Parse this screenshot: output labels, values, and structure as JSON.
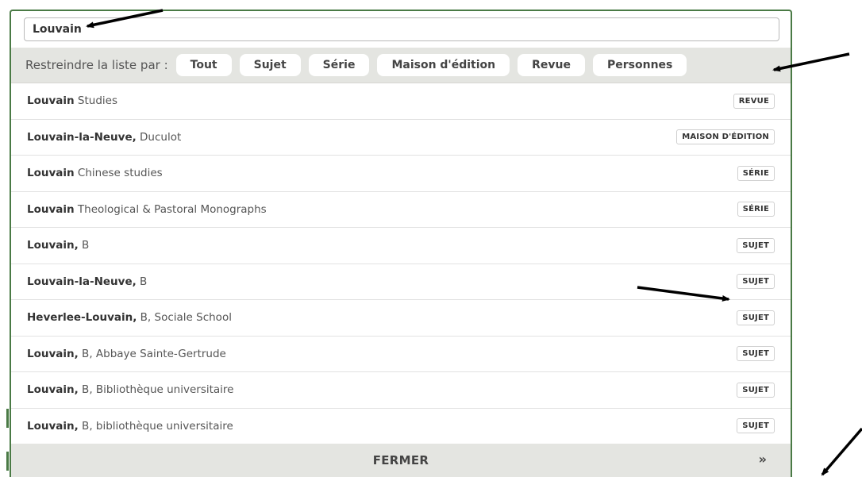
{
  "search": {
    "value": "Louvain"
  },
  "filter": {
    "label": "Restreindre la liste par :",
    "chips": [
      "Tout",
      "Sujet",
      "Série",
      "Maison d'édition",
      "Revue",
      "Personnes"
    ]
  },
  "results": [
    {
      "bold": "Louvain",
      "rest": " Studies",
      "badge": "REVUE"
    },
    {
      "bold": "Louvain-la-Neuve,",
      "rest": " Duculot",
      "badge": "MAISON D'ÉDITION"
    },
    {
      "bold": "Louvain",
      "rest": " Chinese studies",
      "badge": "SÉRIE"
    },
    {
      "bold": "Louvain",
      "rest": " Theological & Pastoral Monographs",
      "badge": "SÉRIE"
    },
    {
      "bold": "Louvain,",
      "rest": " B",
      "badge": "SUJET"
    },
    {
      "bold": "Louvain-la-Neuve,",
      "rest": " B",
      "badge": "SUJET"
    },
    {
      "bold": "Heverlee-Louvain,",
      "rest": " B, Sociale School",
      "badge": "SUJET"
    },
    {
      "bold": "Louvain,",
      "rest": " B, Abbaye Sainte-Gertrude",
      "badge": "SUJET"
    },
    {
      "bold": "Louvain,",
      "rest": " B, Bibliothèque universitaire",
      "badge": "SUJET"
    },
    {
      "bold": "Louvain,",
      "rest": " B, bibliothèque universitaire",
      "badge": "SUJET"
    }
  ],
  "footer": {
    "close_label": "FERMER",
    "arrow": "»"
  },
  "colors": {
    "accent": "#4a7a45",
    "bar": "#e4e5e1",
    "annotation": "#000000"
  }
}
